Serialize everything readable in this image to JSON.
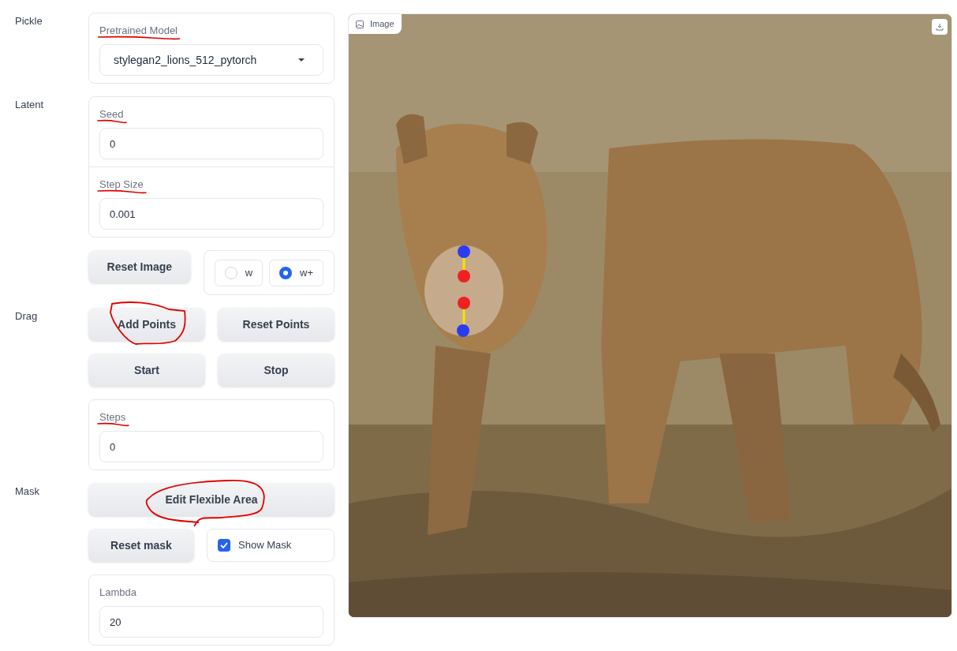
{
  "sections": [
    {
      "label": "Pickle",
      "blocks": [
        {
          "kind": "card",
          "fields": [
            {
              "kind": "dropdown",
              "label": "Pretrained Model",
              "underlined": true,
              "value": "stylegan2_lions_512_pytorch"
            }
          ]
        }
      ]
    },
    {
      "label": "Latent",
      "blocks": [
        {
          "kind": "card",
          "fields": [
            {
              "kind": "number",
              "label": "Seed",
              "underlined": true,
              "value": "0"
            },
            {
              "kind": "number",
              "label": "Step Size",
              "underlined": true,
              "value": "0.001"
            }
          ]
        },
        {
          "kind": "row",
          "items": [
            {
              "kind": "button",
              "label": "Reset Image",
              "circled": false
            },
            {
              "kind": "radio_group",
              "options": [
                {
                  "label": "w",
                  "selected": false
                },
                {
                  "label": "w+",
                  "selected": true
                }
              ]
            }
          ]
        }
      ]
    },
    {
      "label": "Drag",
      "blocks": [
        {
          "kind": "row",
          "items": [
            {
              "kind": "button",
              "label": "Add Points",
              "circled": true
            },
            {
              "kind": "button",
              "label": "Reset Points",
              "circled": false
            }
          ]
        },
        {
          "kind": "row",
          "items": [
            {
              "kind": "button",
              "label": "Start",
              "circled": false
            },
            {
              "kind": "button",
              "label": "Stop",
              "circled": false
            }
          ]
        },
        {
          "kind": "card",
          "fields": [
            {
              "kind": "number",
              "label": "Steps",
              "underlined": true,
              "value": "0"
            }
          ]
        }
      ]
    },
    {
      "label": "Mask",
      "blocks": [
        {
          "kind": "row",
          "items": [
            {
              "kind": "button",
              "label": "Edit Flexible Area",
              "circled": true
            }
          ]
        },
        {
          "kind": "row",
          "items": [
            {
              "kind": "button",
              "label": "Reset mask",
              "circled": false
            },
            {
              "kind": "checkbox",
              "label": "Show Mask",
              "checked": true
            }
          ]
        },
        {
          "kind": "card",
          "fields": [
            {
              "kind": "number",
              "label": "Lambda",
              "underlined": false,
              "value": "20"
            }
          ]
        }
      ]
    }
  ],
  "image": {
    "label": "Image"
  }
}
